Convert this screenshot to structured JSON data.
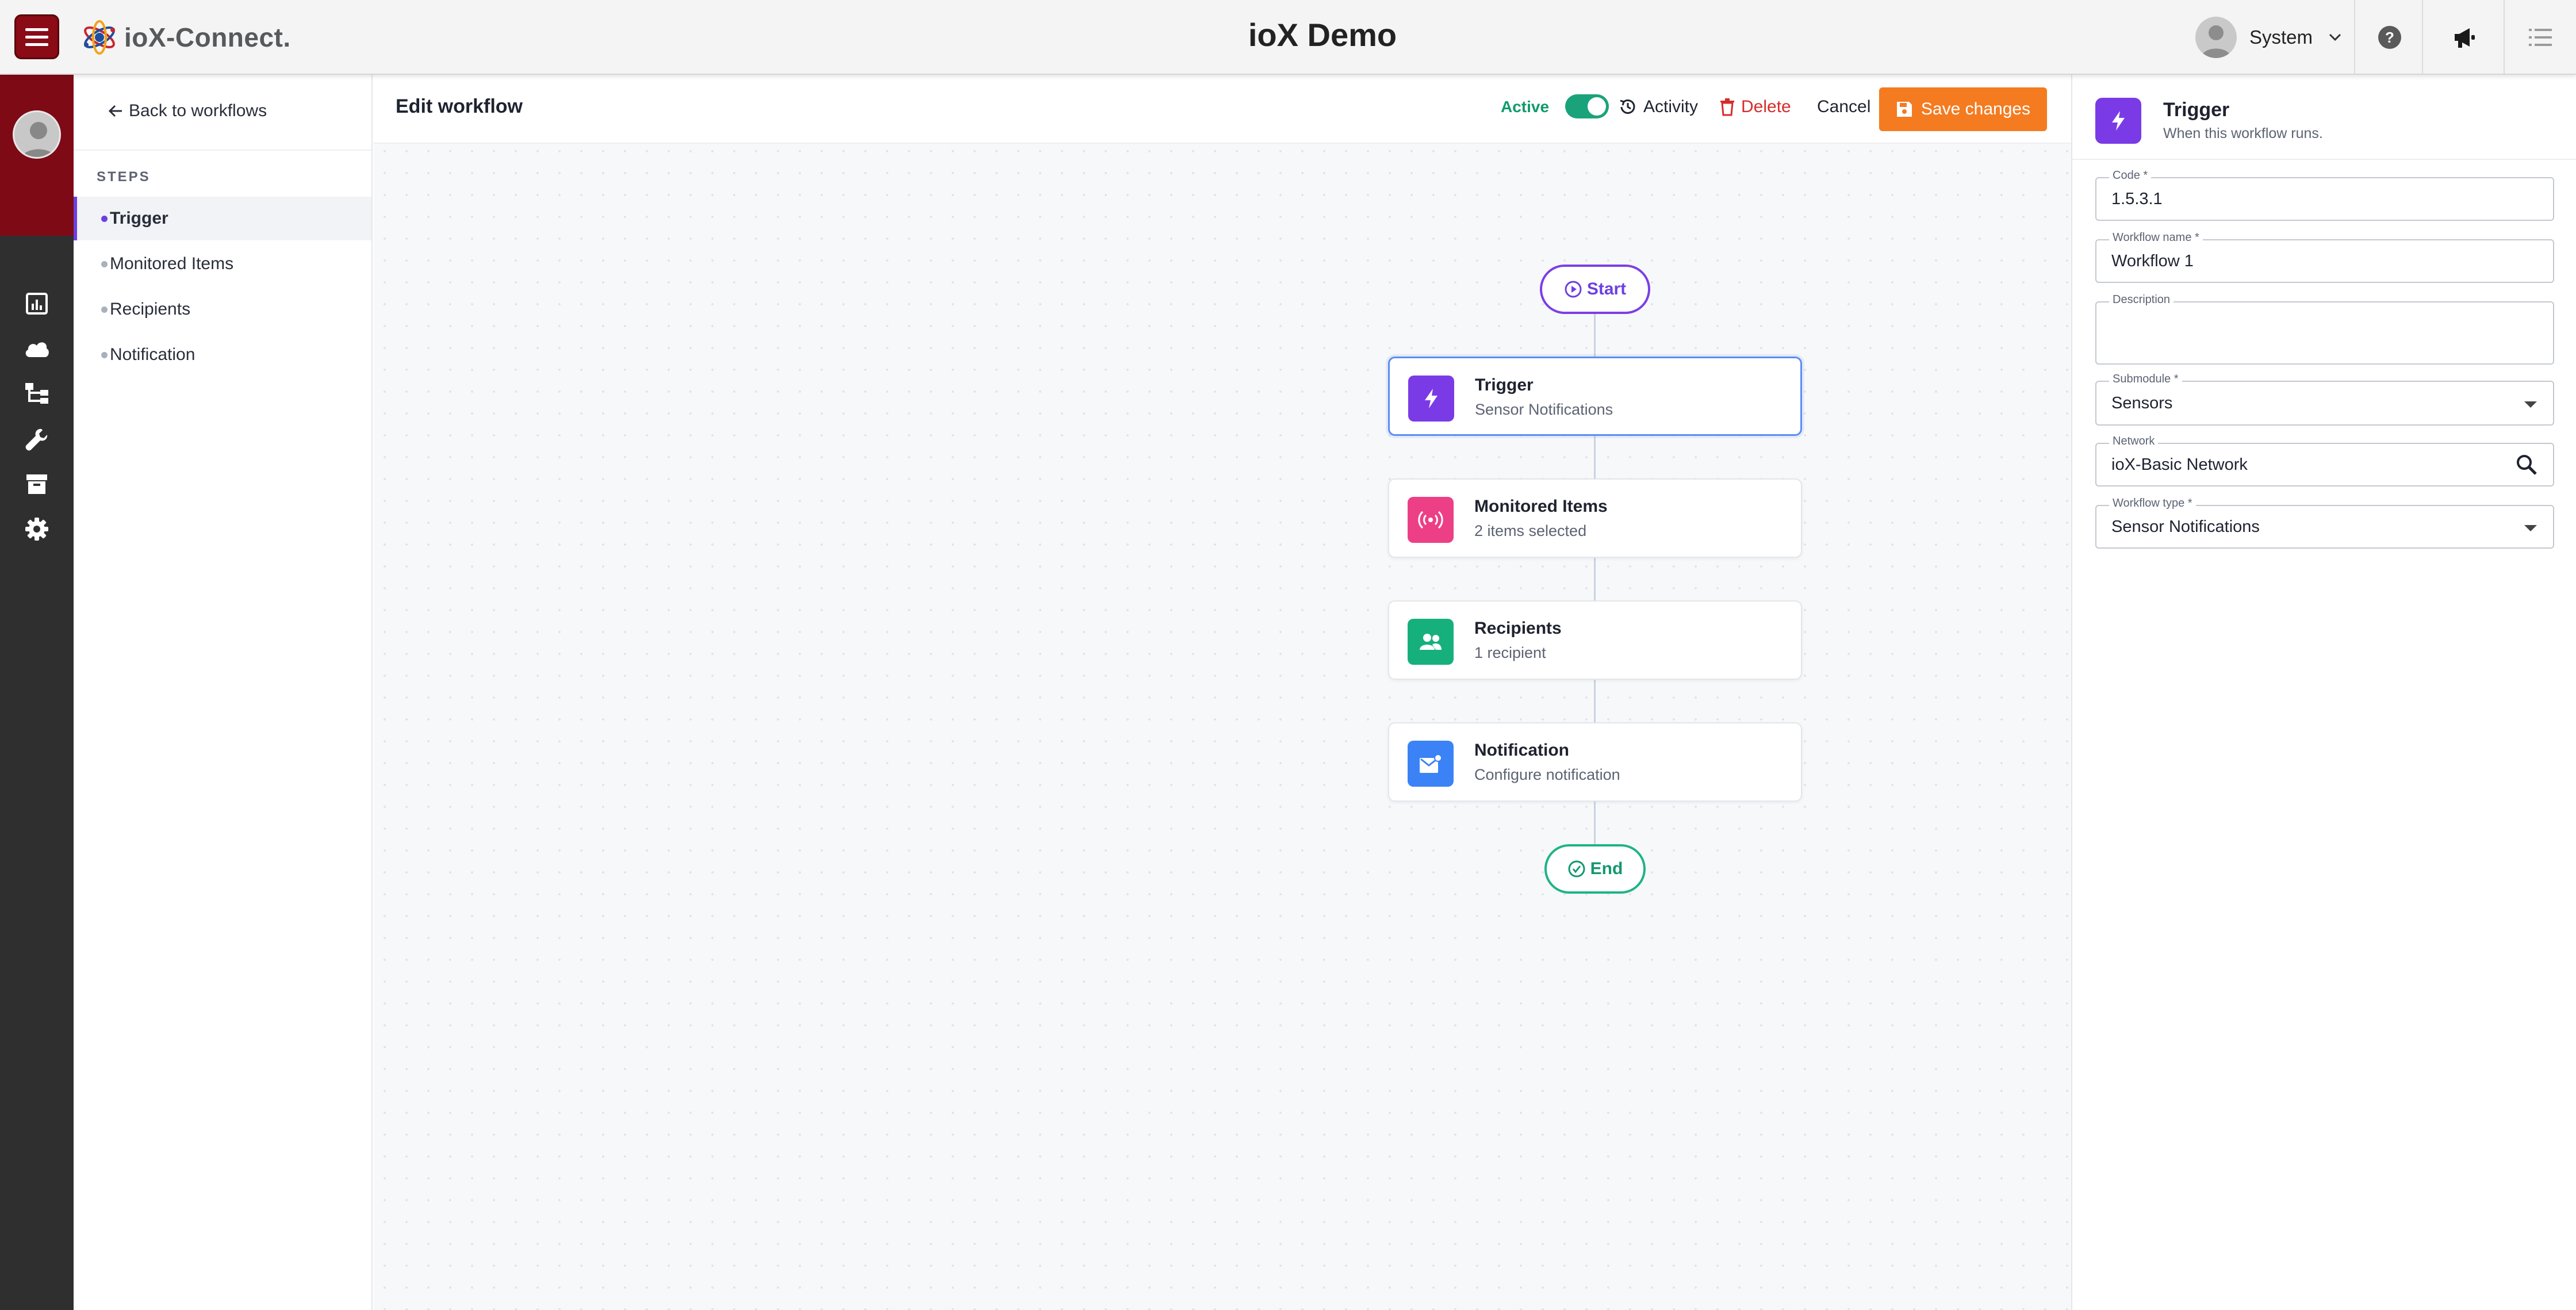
{
  "header": {
    "brand": "ioX-Connect.",
    "title": "ioX Demo",
    "user": "System"
  },
  "steps_nav": {
    "back_label": "Back to workflows",
    "heading": "STEPS",
    "items": [
      {
        "label": "Trigger",
        "active": true
      },
      {
        "label": "Monitored Items",
        "active": false
      },
      {
        "label": "Recipients",
        "active": false
      },
      {
        "label": "Notification",
        "active": false
      }
    ]
  },
  "main": {
    "title": "Edit workflow",
    "active_label": "Active",
    "active_on": true,
    "activity_label": "Activity",
    "delete_label": "Delete",
    "cancel_label": "Cancel",
    "save_label": "Save changes"
  },
  "flow": {
    "start_label": "Start",
    "end_label": "End",
    "cards": [
      {
        "title": "Trigger",
        "subtitle": "Sensor Notifications",
        "icon": "bolt-icon",
        "color": "#7a3be6"
      },
      {
        "title": "Monitored Items",
        "subtitle": "2 items selected",
        "icon": "broadcast-icon",
        "color": "#ec3f86"
      },
      {
        "title": "Recipients",
        "subtitle": "1 recipient",
        "icon": "people-icon",
        "color": "#16b07c"
      },
      {
        "title": "Notification",
        "subtitle": "Configure notification",
        "icon": "mail-icon",
        "color": "#3b82f6"
      }
    ]
  },
  "panel": {
    "title": "Trigger",
    "subtitle": "When this workflow runs.",
    "fields": {
      "code": {
        "label": "Code *",
        "value": "1.5.3.1"
      },
      "name": {
        "label": "Workflow name *",
        "value": "Workflow 1"
      },
      "description": {
        "label": "Description",
        "value": ""
      },
      "submodule": {
        "label": "Submodule *",
        "value": "Sensors"
      },
      "network": {
        "label": "Network",
        "value": "ioX-Basic Network"
      },
      "workflow_type": {
        "label": "Workflow type *",
        "value": "Sensor Notifications"
      }
    }
  },
  "colors": {
    "brand_red": "#8a0a15",
    "save_orange": "#f47b20",
    "active_green": "#1aa37a",
    "trigger_purple": "#7a3be6",
    "selected_blue": "#5b8def"
  }
}
